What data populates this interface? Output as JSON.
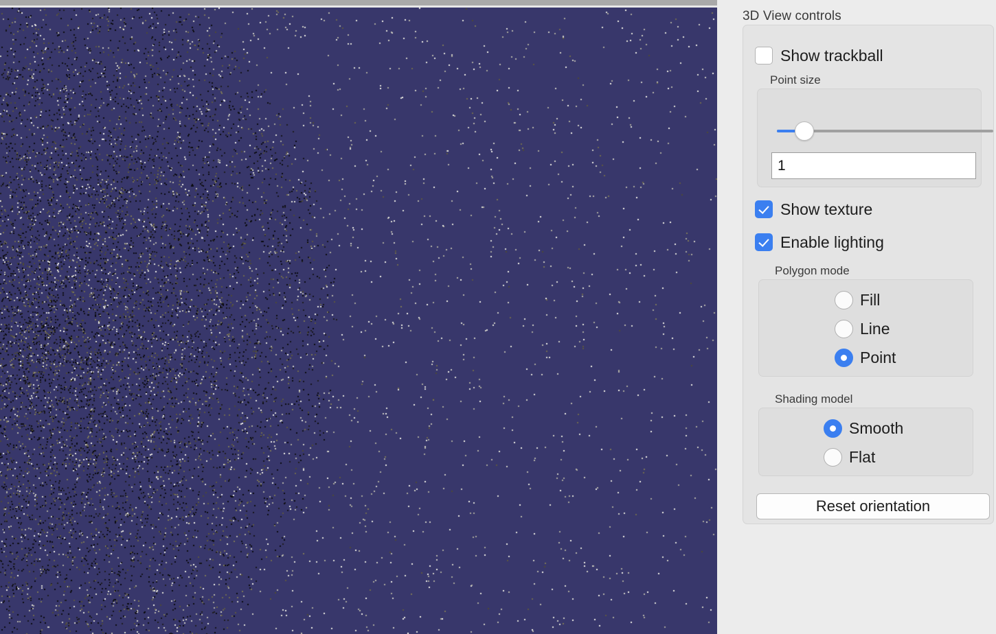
{
  "viewport": {
    "name": "3d-point-cloud-viewport",
    "background_color": "#38376b",
    "render_mode": "point",
    "point_colors": [
      "#0e0e12",
      "#6f6a4e",
      "#b9b8ae",
      "#e6e5e0",
      "#8d8a73"
    ]
  },
  "panel": {
    "title": "3D View controls",
    "trackball": {
      "label": "Show trackball",
      "checked": false
    },
    "point_size": {
      "group_label": "Point size",
      "value": "1",
      "slider_min": 1,
      "slider_max": 30,
      "slider_value": 1,
      "accent_color": "#3b7ff0"
    },
    "show_texture": {
      "label": "Show texture",
      "checked": true
    },
    "enable_lighting": {
      "label": "Enable lighting",
      "checked": true
    },
    "polygon_mode": {
      "group_label": "Polygon mode",
      "options": [
        {
          "label": "Fill",
          "selected": false
        },
        {
          "label": "Line",
          "selected": false
        },
        {
          "label": "Point",
          "selected": true
        }
      ]
    },
    "shading_model": {
      "group_label": "Shading model",
      "options": [
        {
          "label": "Smooth",
          "selected": true
        },
        {
          "label": "Flat",
          "selected": false
        }
      ]
    },
    "reset_button": {
      "label": "Reset orientation"
    }
  }
}
